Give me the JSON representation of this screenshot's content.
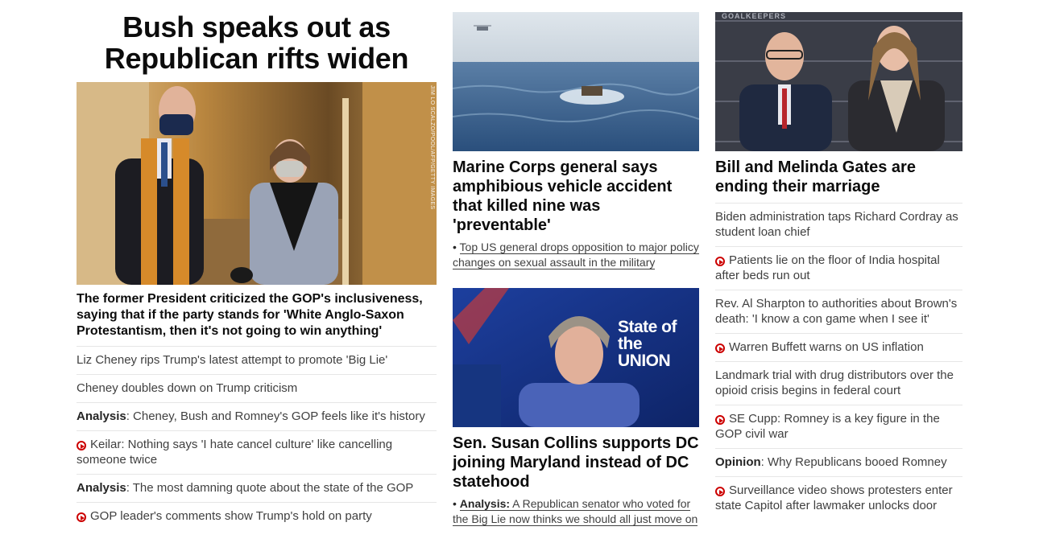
{
  "lead": {
    "headline": "Bush speaks out as Republican rifts widen",
    "photo_credit": "JIM LO SCALZO/POOL/AFP/GETTY IMAGES",
    "subhead": "The former President criticized the GOP's inclusiveness, saying that if the party stands for 'White Anglo-Saxon Protestantism, then it's not going to win anything'",
    "stories": [
      {
        "kicker": "",
        "video": false,
        "text": "Liz Cheney rips Trump's latest attempt to promote 'Big Lie'"
      },
      {
        "kicker": "",
        "video": false,
        "text": "Cheney doubles down on Trump criticism"
      },
      {
        "kicker": "Analysis",
        "video": false,
        "text": ": Cheney, Bush and Romney's GOP feels like it's history"
      },
      {
        "kicker": "",
        "video": true,
        "text": "Keilar: Nothing says 'I hate cancel culture' like cancelling someone twice"
      },
      {
        "kicker": "Analysis",
        "video": false,
        "text": ": The most damning quote about the state of the GOP"
      },
      {
        "kicker": "",
        "video": true,
        "text": "GOP leader's comments show Trump's hold on party"
      }
    ]
  },
  "middle": {
    "card1": {
      "title": "Marine Corps general says amphibious vehicle accident that killed nine was 'preventable'",
      "bullet_mark": "•",
      "bullet_text": "Top US general drops opposition to major policy changes on sexual assault in the military"
    },
    "card2": {
      "title": "Sen. Susan Collins supports DC joining Maryland instead of DC statehood",
      "bullet_mark": "•",
      "bullet_kicker": "Analysis:",
      "bullet_text": "A Republican senator who voted for the Big Lie now thinks we should all just move on",
      "screen_text": "State of the UNION"
    }
  },
  "right": {
    "card": {
      "title": "Bill and Melinda Gates are ending their marriage",
      "backdrop_text": "GOALKEEPERS"
    },
    "stories": [
      {
        "kicker": "",
        "video": false,
        "text": "Biden administration taps Richard Cordray as student loan chief"
      },
      {
        "kicker": "",
        "video": true,
        "text": "Patients lie on the floor of India hospital after beds run out"
      },
      {
        "kicker": "",
        "video": false,
        "text": "Rev. Al Sharpton to authorities about Brown's death: 'I know a con game when I see it'"
      },
      {
        "kicker": "",
        "video": true,
        "text": "Warren Buffett warns on US inflation"
      },
      {
        "kicker": "",
        "video": false,
        "text": "Landmark trial with drug distributors over the opioid crisis begins in federal court"
      },
      {
        "kicker": "",
        "video": true,
        "text": "SE Cupp: Romney is a key figure in the GOP civil war"
      },
      {
        "kicker": "Opinion",
        "video": false,
        "text": ": Why Republicans booed Romney"
      },
      {
        "kicker": "",
        "video": true,
        "text": "Surveillance video shows protesters enter state Capitol after lawmaker unlocks door"
      }
    ]
  },
  "colors": {
    "video_red": "#cc0000",
    "text": "#262626",
    "divider": "#e6e6e6"
  }
}
